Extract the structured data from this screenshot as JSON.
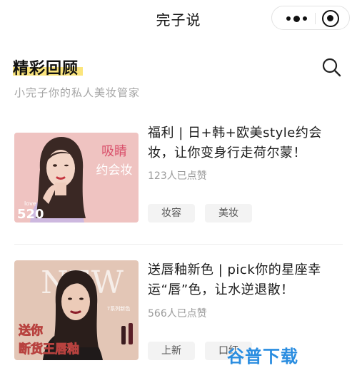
{
  "header": {
    "title": "完子说"
  },
  "section": {
    "title": "精彩回顾",
    "subtitle": "小完子你的私人美妆管家"
  },
  "cards": [
    {
      "title": "福利 | 日+韩+欧美style约会妆，让你变身行走荷尔蒙！",
      "meta": "123人已点赞",
      "tags": [
        "妆容",
        "美妆"
      ],
      "thumb_overlay": [
        "吸睛",
        "约会妆"
      ],
      "thumb_badge_small": "love",
      "thumb_badge_big": "520"
    },
    {
      "title": "送唇釉新色 | pick你的星座幸运“唇”色，让水逆退散！",
      "meta": "566人已点赞",
      "tags": [
        "上新",
        "口红"
      ],
      "thumb_overlay": [
        "送你",
        "断货王唇釉"
      ],
      "thumb_bg_letters": "NEW",
      "thumb_small": "7系列新色"
    }
  ],
  "watermark": "谷普下载"
}
